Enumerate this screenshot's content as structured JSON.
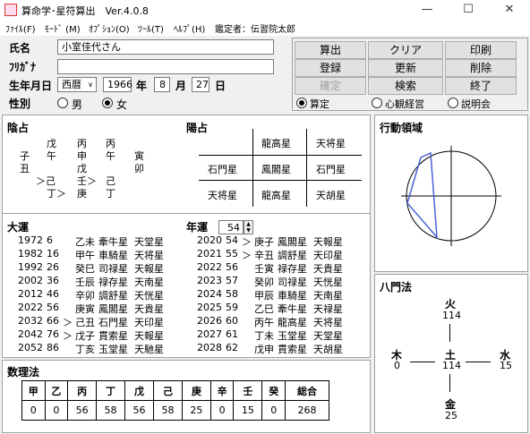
{
  "window": {
    "title": "算命学･星符算出　Ver.4.0.8"
  },
  "menu": [
    "ﾌｧｲﾙ(F)",
    "ﾓｰﾄﾞ (M)",
    "ｵﾌﾟｼｮﾝ(O)",
    "ﾂｰﾙ(T)",
    "ﾍﾙﾌﾟ(H)",
    "鑑定者：伝習院太郎"
  ],
  "form": {
    "name_label": "氏名",
    "name_value": "小室佳代さん",
    "furigana_label": "ﾌﾘｶﾞﾅ",
    "furigana_value": "",
    "birth_label": "生年月日",
    "era": "西暦",
    "year": "1966",
    "year_unit": "年",
    "month": "8",
    "month_unit": "月",
    "day": "27",
    "day_unit": "日",
    "sex_label": "性別",
    "male": "男",
    "female": "女",
    "selected_sex": "女"
  },
  "buttons": {
    "calc": "算出",
    "clear": "クリア",
    "print": "印刷",
    "register": "登録",
    "update": "更新",
    "delete": "削除",
    "confirm": "確定",
    "search": "検索",
    "exit": "終了"
  },
  "modes": {
    "kantei": "算定",
    "shinkan": "心観経営",
    "setsumei": "説明会",
    "selected": "算定"
  },
  "inyo": {
    "title": "陰占",
    "rows": [
      [
        "",
        "戊",
        "丙",
        "丙",
        ""
      ],
      [
        "子",
        "午",
        "申",
        "午",
        "寅"
      ],
      [
        "丑",
        "",
        "戊",
        "",
        "卯"
      ],
      [
        "",
        "＞己",
        "壬＞",
        "己",
        ""
      ],
      [
        "",
        "丁＞",
        "庚",
        "丁",
        ""
      ]
    ]
  },
  "yosen": {
    "title": "陽占",
    "grid": [
      [
        "",
        "龍高星",
        "天将星"
      ],
      [
        "石門星",
        "鳳閣星",
        "石門星"
      ],
      [
        "天将星",
        "龍高星",
        "天胡星"
      ]
    ]
  },
  "taiun": {
    "title": "大運",
    "rows": [
      [
        "1972",
        "6",
        "",
        "乙未",
        "牽牛星",
        "天堂星"
      ],
      [
        "1982",
        "16",
        "",
        "甲午",
        "車騎星",
        "天将星"
      ],
      [
        "1992",
        "26",
        "",
        "癸巳",
        "司禄星",
        "天報星"
      ],
      [
        "2002",
        "36",
        "",
        "壬辰",
        "禄存星",
        "天南星"
      ],
      [
        "2012",
        "46",
        "",
        "辛卯",
        "調舒星",
        "天恍星"
      ],
      [
        "2022",
        "56",
        "",
        "庚寅",
        "鳳閣星",
        "天貴星"
      ],
      [
        "2032",
        "66",
        "＞",
        "己丑",
        "石門星",
        "天印星"
      ],
      [
        "2042",
        "76",
        "＞",
        "戊子",
        "貫索星",
        "天報星"
      ],
      [
        "2052",
        "86",
        "",
        "丁亥",
        "玉堂星",
        "天馳星"
      ]
    ]
  },
  "nenun": {
    "title": "年運",
    "age": "54",
    "rows": [
      [
        "2020",
        "54",
        "＞",
        "庚子",
        "鳳閣星",
        "天報星"
      ],
      [
        "2021",
        "55",
        "＞",
        "辛丑",
        "調舒星",
        "天印星"
      ],
      [
        "2022",
        "56",
        "",
        "壬寅",
        "禄存星",
        "天貴星"
      ],
      [
        "2023",
        "57",
        "",
        "癸卯",
        "司禄星",
        "天恍星"
      ],
      [
        "2024",
        "58",
        "",
        "甲辰",
        "車騎星",
        "天南星"
      ],
      [
        "2025",
        "59",
        "",
        "乙巳",
        "牽牛星",
        "天禄星"
      ],
      [
        "2026",
        "60",
        "",
        "丙午",
        "龍高星",
        "天将星"
      ],
      [
        "2027",
        "61",
        "",
        "丁未",
        "玉堂星",
        "天堂星"
      ],
      [
        "2028",
        "62",
        "",
        "戊申",
        "貫索星",
        "天胡星"
      ]
    ]
  },
  "suri": {
    "title": "数理法",
    "headers": [
      "甲",
      "乙",
      "丙",
      "丁",
      "戊",
      "己",
      "庚",
      "辛",
      "壬",
      "癸",
      "総合"
    ],
    "values": [
      "0",
      "0",
      "56",
      "58",
      "56",
      "58",
      "25",
      "0",
      "15",
      "0",
      "268"
    ]
  },
  "kodo": {
    "title": "行動領域"
  },
  "hachimon": {
    "title": "八門法",
    "fire": "火",
    "fire_v": "114",
    "wood": "木",
    "wood_v": "0",
    "earth": "土",
    "earth_v": "114",
    "water": "水",
    "water_v": "15",
    "metal": "金",
    "metal_v": "25"
  }
}
